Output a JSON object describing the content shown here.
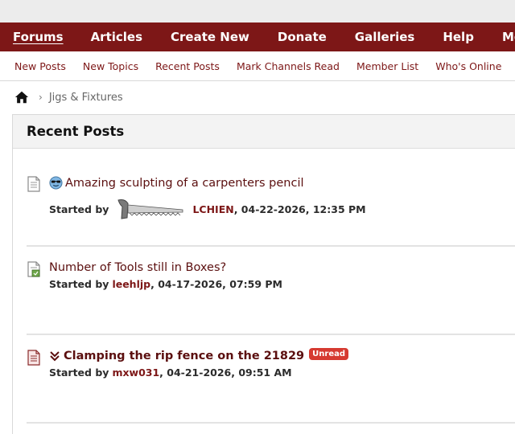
{
  "main_nav": [
    {
      "label": "Forums",
      "active": true
    },
    {
      "label": "Articles"
    },
    {
      "label": "Create New"
    },
    {
      "label": "Donate"
    },
    {
      "label": "Galleries"
    },
    {
      "label": "Help"
    },
    {
      "label": "Moderation"
    }
  ],
  "sub_nav": [
    "New Posts",
    "New Topics",
    "Recent Posts",
    "Mark Channels Read",
    "Member List",
    "Who's Online"
  ],
  "breadcrumb": {
    "current": "Jigs & Fixtures"
  },
  "panel": {
    "title": "Recent Posts"
  },
  "posts": [
    {
      "title": "Amazing sculpting of a carpenters pencil",
      "started_by_label": "Started by",
      "author": "LCHIEN",
      "datetime": ", 04-22-2026, 12:35 PM",
      "icon": "smiley-sunglasses-icon",
      "unread": false
    },
    {
      "title": "Number of Tools still in Boxes?",
      "started_by_label": "Started by",
      "author": "leehljp",
      "datetime": ", 04-17-2026, 07:59 PM",
      "unread": false
    },
    {
      "title": "Clamping the rip fence on the 21829",
      "started_by_label": "Started by",
      "author": "mxw031",
      "datetime": ", 04-21-2026, 09:51 AM",
      "badge": "Unread",
      "unread": true
    }
  ],
  "colors": {
    "brand": "#7d1717",
    "badge": "#d63a31"
  }
}
